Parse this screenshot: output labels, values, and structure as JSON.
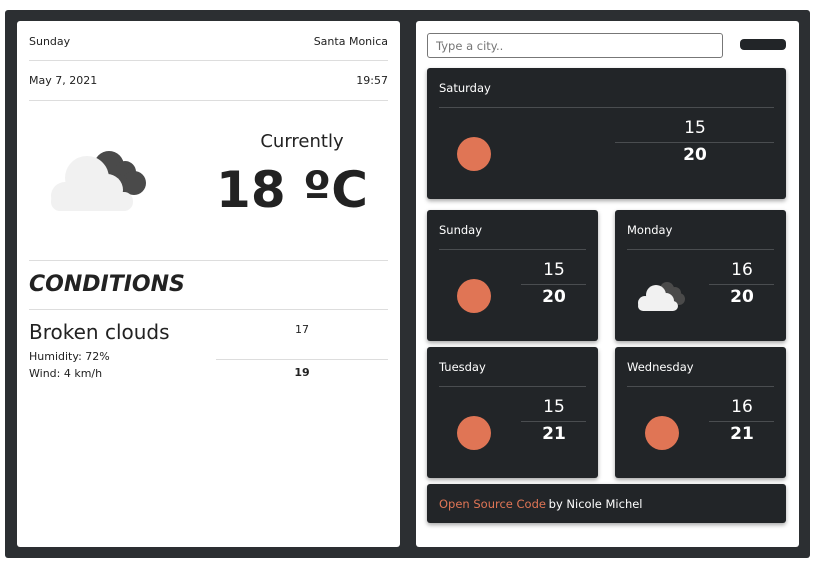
{
  "current": {
    "day": "Sunday",
    "city": "Santa Monica",
    "date": "May 7, 2021",
    "time": "19:57",
    "heading": "Currently",
    "temperature": "18 ºC",
    "icon": "broken-clouds-icon",
    "conditions_title": "CONDITIONS",
    "description": "Broken clouds",
    "humidity": "Humidity: 72%",
    "wind": "Wind: 4 km/h",
    "min": "17",
    "max": "19"
  },
  "search": {
    "placeholder": "Type a city..",
    "value": ""
  },
  "forecast": [
    {
      "day": "Saturday",
      "min": "15",
      "max": "20",
      "icon": "sun-icon"
    },
    {
      "day": "Sunday",
      "min": "15",
      "max": "20",
      "icon": "sun-icon"
    },
    {
      "day": "Monday",
      "min": "16",
      "max": "20",
      "icon": "cloud-icon"
    },
    {
      "day": "Tuesday",
      "min": "15",
      "max": "21",
      "icon": "sun-icon"
    },
    {
      "day": "Wednesday",
      "min": "16",
      "max": "21",
      "icon": "sun-icon"
    }
  ],
  "footer": {
    "link": "Open Source Code",
    "by": " by Nicole Michel"
  },
  "colors": {
    "accent": "#e07555",
    "card": "#222528",
    "frame": "#2c2f32"
  }
}
